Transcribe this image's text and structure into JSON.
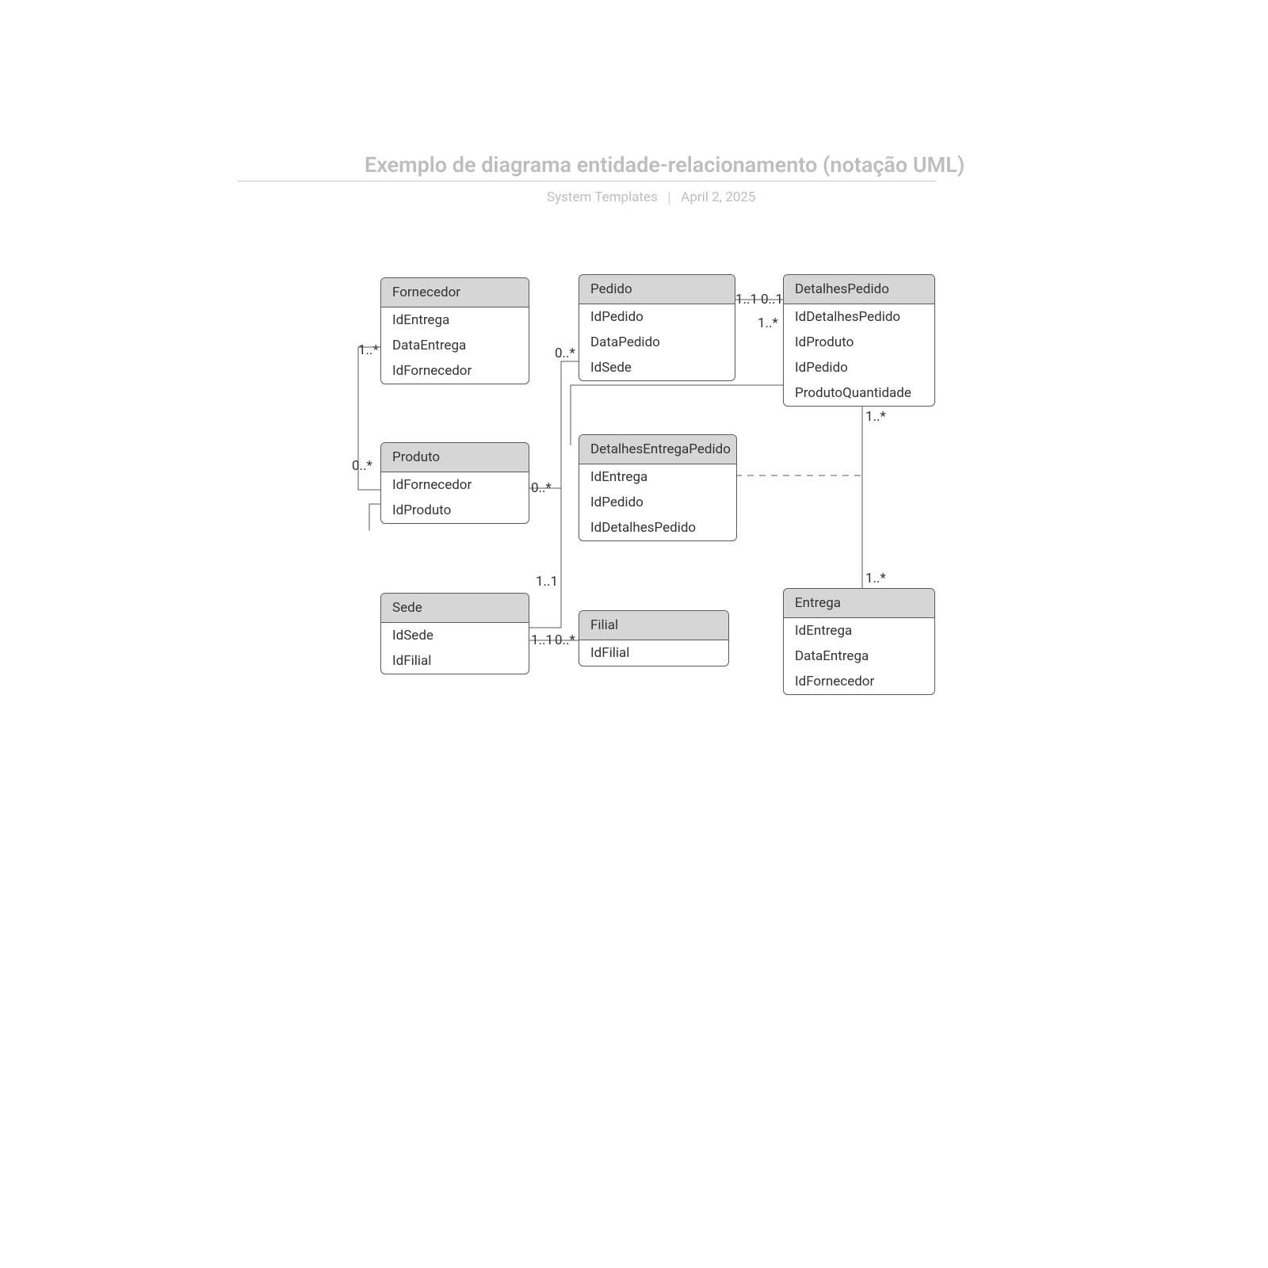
{
  "header": {
    "title": "Exemplo de diagrama entidade-relacionamento (notação UML)",
    "author": "System Templates",
    "date": "April 2, 2025"
  },
  "entities": {
    "fornecedor": {
      "name": "Fornecedor",
      "attrs": [
        "IdEntrega",
        "DataEntrega",
        "IdFornecedor"
      ]
    },
    "pedido": {
      "name": "Pedido",
      "attrs": [
        "IdPedido",
        "DataPedido",
        "IdSede"
      ]
    },
    "detalhesPedido": {
      "name": "DetalhesPedido",
      "attrs": [
        "IdDetalhesPedido",
        "IdProduto",
        "IdPedido",
        "ProdutoQuantidade"
      ]
    },
    "produto": {
      "name": "Produto",
      "attrs": [
        "IdFornecedor",
        "IdProduto"
      ]
    },
    "detalhesEntregaPedido": {
      "name": "DetalhesEntregaPedido",
      "attrs": [
        "IdEntrega",
        "IdPedido",
        "IdDetalhesPedido"
      ]
    },
    "sede": {
      "name": "Sede",
      "attrs": [
        "IdSede",
        "IdFilial"
      ]
    },
    "filial": {
      "name": "Filial",
      "attrs": [
        "IdFilial"
      ]
    },
    "entrega": {
      "name": "Entrega",
      "attrs": [
        "IdEntrega",
        "DataEntrega",
        "IdFornecedor"
      ]
    }
  },
  "multiplicities": {
    "fornecedor_produto_top": "1..*",
    "fornecedor_produto_bot": "0..*",
    "produto_pedido": "0..*",
    "pedido_sede": "0..*",
    "sede_pedido": "1..1",
    "sede_filial_left": "1..1",
    "sede_filial_right": "0..*",
    "pedido_detalhes_left": "1..1",
    "pedido_detalhes_right": "0..1",
    "detalhes_top": "1..*",
    "detalhes_entrega_top": "1..*",
    "detalhes_entrega_bot": "1..*"
  }
}
